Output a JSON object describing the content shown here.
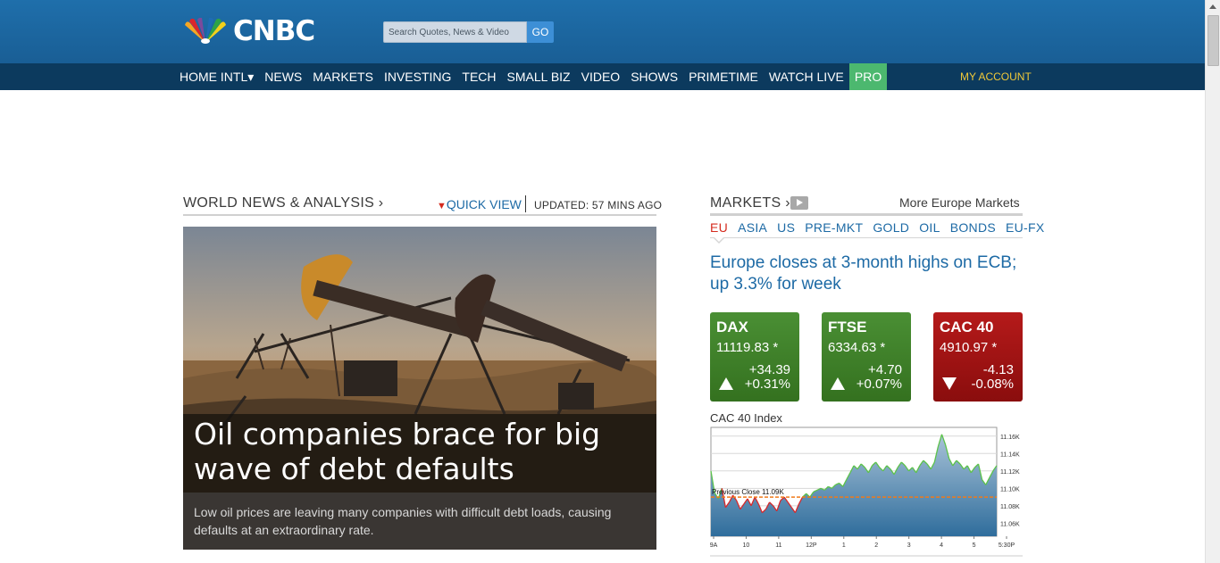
{
  "header": {
    "logo_text": "CNBC",
    "search": {
      "placeholder": "Search Quotes, News & Video",
      "button": "GO"
    }
  },
  "nav": {
    "items": [
      {
        "key": "home",
        "label": "HOME INTL▾"
      },
      {
        "key": "news",
        "label": "NEWS"
      },
      {
        "key": "markets",
        "label": "MARKETS"
      },
      {
        "key": "investing",
        "label": "INVESTING"
      },
      {
        "key": "tech",
        "label": "TECH"
      },
      {
        "key": "small-biz",
        "label": "SMALL BIZ"
      },
      {
        "key": "video",
        "label": "VIDEO"
      },
      {
        "key": "shows",
        "label": "SHOWS"
      },
      {
        "key": "primetime",
        "label": "PRIMETIME"
      },
      {
        "key": "watch-live",
        "label": "WATCH LIVE"
      },
      {
        "key": "pro",
        "label": "PRO"
      }
    ],
    "my_account": "MY ACCOUNT"
  },
  "world_news": {
    "heading": "WORLD NEWS & ANALYSIS ›",
    "quick_view_arrow": "▼",
    "quick_view": "QUICK VIEW",
    "updated": "UPDATED: 57 MINS AGO",
    "hero": {
      "title": "Oil companies brace for big wave of debt defaults",
      "dek": "Low oil prices are leaving many companies with difficult debt loads, causing defaults at an extraordinary rate."
    }
  },
  "markets": {
    "heading": "MARKETS ›",
    "more_link": "More Europe Markets",
    "tabs": [
      "EU",
      "ASIA",
      "US",
      "PRE-MKT",
      "GOLD",
      "OIL",
      "BONDS",
      "EU-FX"
    ],
    "active_tab": "EU",
    "headline": "Europe closes at 3-month highs on ECB; up 3.3% for week",
    "tickers": [
      {
        "name": "DAX",
        "value": "11119.83 *",
        "change": "+34.39",
        "pct": "+0.31%",
        "direction": "up"
      },
      {
        "name": "FTSE",
        "value": "6334.63 *",
        "change": "+4.70",
        "pct": "+0.07%",
        "direction": "up"
      },
      {
        "name": "CAC 40",
        "value": "4910.97 *",
        "change": "-4.13",
        "pct": "-0.08%",
        "direction": "down"
      }
    ],
    "colors": {
      "up": "#3b7f2a",
      "down": "#a01414",
      "accent": "#1d6aa5"
    }
  },
  "chart_data": {
    "type": "area",
    "title": "CAC 40 Index",
    "y_tick_labels": [
      "11.16K",
      "11.14K",
      "11.12K",
      "11.10K",
      "11.08K",
      "11.06K"
    ],
    "y_ticks": [
      11160,
      11140,
      11120,
      11100,
      11080,
      11060
    ],
    "ylim": [
      11045,
      11170
    ],
    "x_tick_labels": [
      "9A",
      "10",
      "11",
      "12P",
      "1",
      "2",
      "3",
      "4",
      "5",
      "5:30P"
    ],
    "reference_line": {
      "label": "Previous Close 11.09K",
      "value": 11090
    },
    "series": [
      {
        "values": [
          11120,
          11095,
          11088,
          11100,
          11078,
          11084,
          11092,
          11086,
          11076,
          11082,
          11088,
          11080,
          11090,
          11082,
          11072,
          11076,
          11084,
          11080,
          11074,
          11086,
          11090,
          11084,
          11078,
          11072,
          11082,
          11090,
          11094,
          11090,
          11096,
          11098,
          11100,
          11098,
          11102,
          11100,
          11104,
          11106,
          11102,
          11110,
          11118,
          11126,
          11122,
          11128,
          11124,
          11118,
          11126,
          11130,
          11124,
          11120,
          11126,
          11122,
          11116,
          11124,
          11130,
          11126,
          11120,
          11124,
          11118,
          11126,
          11132,
          11128,
          11122,
          11130,
          11148,
          11162,
          11150,
          11134,
          11126,
          11132,
          11128,
          11122,
          11126,
          11118,
          11124,
          11128,
          11110,
          11104,
          11112,
          11120,
          11126
        ]
      }
    ]
  }
}
